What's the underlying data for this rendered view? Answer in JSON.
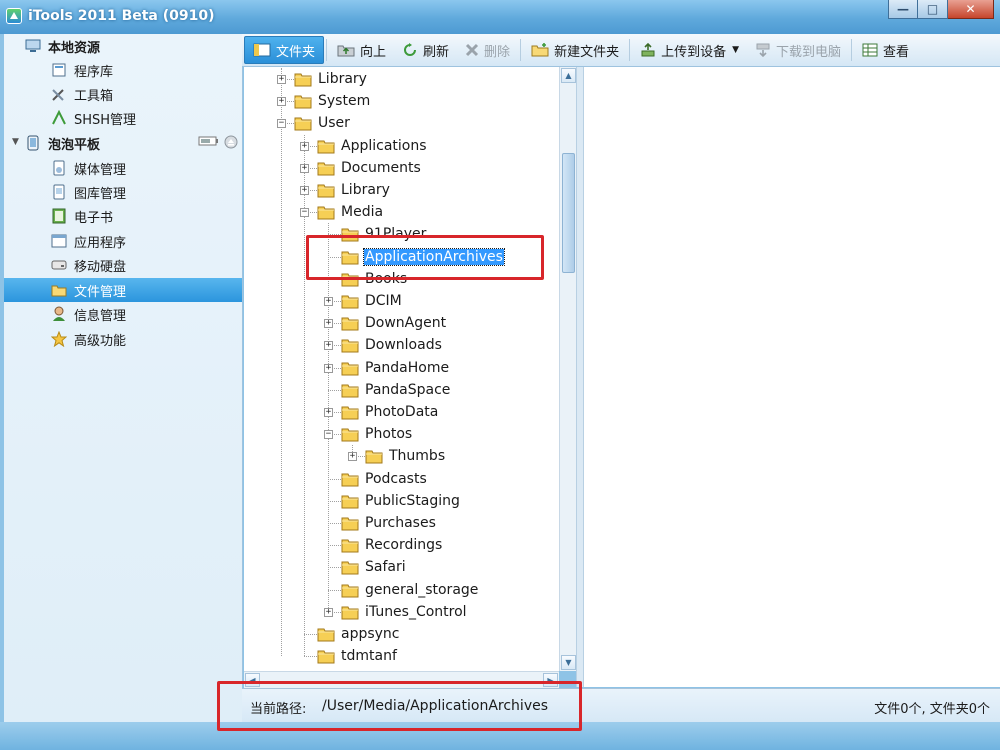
{
  "window": {
    "title": "iTools 2011 Beta (0910)"
  },
  "sidebar": {
    "groups": [
      {
        "label": "本地资源",
        "items": [
          {
            "label": "程序库",
            "icon": "library-icon"
          },
          {
            "label": "工具箱",
            "icon": "tools-icon"
          },
          {
            "label": "SHSH管理",
            "icon": "shsh-icon"
          }
        ]
      },
      {
        "label": "泡泡平板",
        "items": [
          {
            "label": "媒体管理",
            "icon": "media-icon"
          },
          {
            "label": "图库管理",
            "icon": "gallery-icon"
          },
          {
            "label": "电子书",
            "icon": "ebook-icon"
          },
          {
            "label": "应用程序",
            "icon": "apps-icon"
          },
          {
            "label": "移动硬盘",
            "icon": "disk-icon"
          },
          {
            "label": "文件管理",
            "icon": "folder-icon",
            "selected": true
          },
          {
            "label": "信息管理",
            "icon": "contacts-icon"
          },
          {
            "label": "高级功能",
            "icon": "star-icon"
          }
        ]
      }
    ]
  },
  "toolbar": {
    "folder": "文件夹",
    "up": "向上",
    "refresh": "刷新",
    "delete": "删除",
    "new_folder": "新建文件夹",
    "upload": "上传到设备",
    "download": "下载到电脑",
    "view": "查看"
  },
  "tree": [
    {
      "name": "Library",
      "level": 0,
      "expander": "plus"
    },
    {
      "name": "System",
      "level": 0,
      "expander": "plus"
    },
    {
      "name": "User",
      "level": 0,
      "expander": "minus"
    },
    {
      "name": "Applications",
      "level": 1,
      "expander": "plus"
    },
    {
      "name": "Documents",
      "level": 1,
      "expander": "plus"
    },
    {
      "name": "Library",
      "level": 1,
      "expander": "plus"
    },
    {
      "name": "Media",
      "level": 1,
      "expander": "minus"
    },
    {
      "name": "91Player",
      "level": 2,
      "expander": "none"
    },
    {
      "name": "ApplicationArchives",
      "level": 2,
      "expander": "none",
      "selected": true
    },
    {
      "name": "Books",
      "level": 2,
      "expander": "none"
    },
    {
      "name": "DCIM",
      "level": 2,
      "expander": "plus"
    },
    {
      "name": "DownAgent",
      "level": 2,
      "expander": "plus"
    },
    {
      "name": "Downloads",
      "level": 2,
      "expander": "plus"
    },
    {
      "name": "PandaHome",
      "level": 2,
      "expander": "plus"
    },
    {
      "name": "PandaSpace",
      "level": 2,
      "expander": "none"
    },
    {
      "name": "PhotoData",
      "level": 2,
      "expander": "plus"
    },
    {
      "name": "Photos",
      "level": 2,
      "expander": "minus"
    },
    {
      "name": "Thumbs",
      "level": 3,
      "expander": "plus"
    },
    {
      "name": "Podcasts",
      "level": 2,
      "expander": "none"
    },
    {
      "name": "PublicStaging",
      "level": 2,
      "expander": "none"
    },
    {
      "name": "Purchases",
      "level": 2,
      "expander": "none"
    },
    {
      "name": "Recordings",
      "level": 2,
      "expander": "none"
    },
    {
      "name": "Safari",
      "level": 2,
      "expander": "none"
    },
    {
      "name": "general_storage",
      "level": 2,
      "expander": "none"
    },
    {
      "name": "iTunes_Control",
      "level": 2,
      "expander": "plus"
    },
    {
      "name": "appsync",
      "level": 1,
      "expander": "none"
    },
    {
      "name": "tdmtanf",
      "level": 1,
      "expander": "none"
    }
  ],
  "status": {
    "path_label": "当前路径:",
    "path": "/User/Media/ApplicationArchives",
    "counts": "文件0个, 文件夹0个"
  },
  "colors": {
    "accent": "#2b95dd",
    "highlight": "#d8262a",
    "selection": "#3399ff"
  }
}
